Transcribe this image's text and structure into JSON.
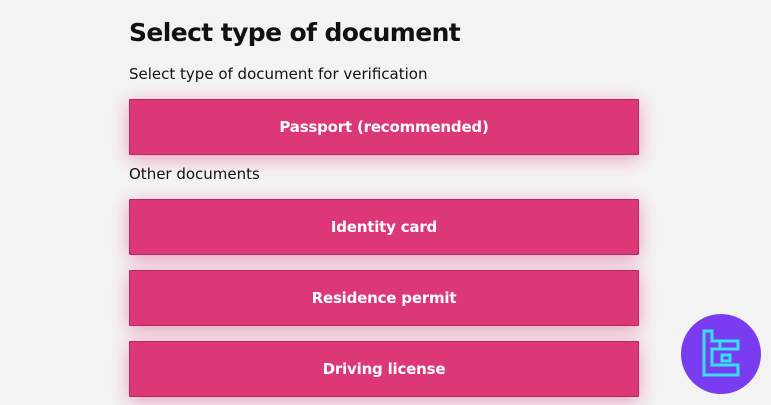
{
  "header": {
    "title": "Select type of document",
    "subtitle": "Select type of document for verification"
  },
  "primary_option": {
    "label": "Passport (recommended)"
  },
  "other": {
    "section_label": "Other documents",
    "options": [
      {
        "label": "Identity card"
      },
      {
        "label": "Residence permit"
      },
      {
        "label": "Driving license"
      }
    ]
  },
  "colors": {
    "button_bg": "#dc3877",
    "page_bg": "#f4f3f4",
    "logo_bg": "#7a3cf0",
    "logo_mark": "#35e0f2"
  },
  "logo": {
    "icon": "brand-logo-icon"
  }
}
